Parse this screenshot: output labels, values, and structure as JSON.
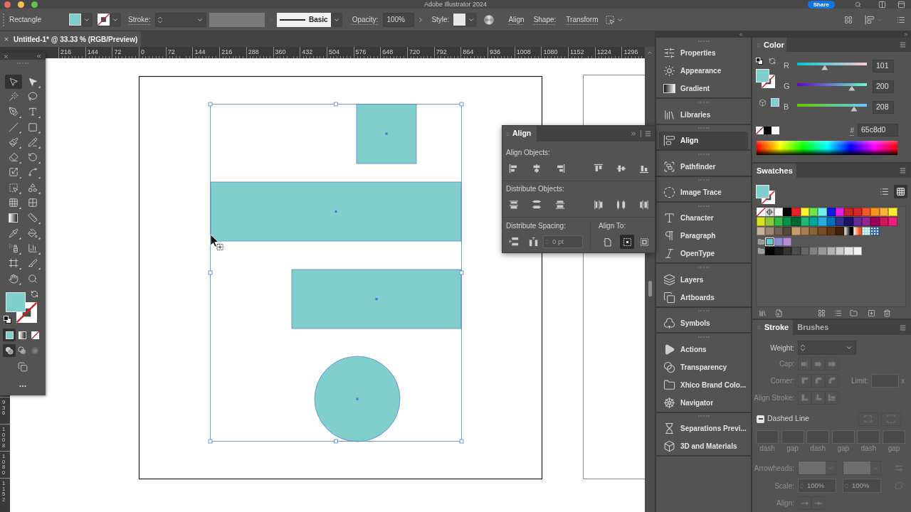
{
  "title_bar": {
    "title": "Adobe Illustrator 2024",
    "share": "Share"
  },
  "control_bar": {
    "object_type": "Rectangle",
    "stroke_label": "Stroke:",
    "brush": "Basic",
    "opacity_label": "Opacity:",
    "opacity": "100%",
    "style_label": "Style:",
    "links": [
      "Align",
      "Shape:",
      "Transform"
    ]
  },
  "document_tabs": [
    {
      "label": "Untitled-1* @ 33.33 % (RGB/Preview)",
      "selected": true
    }
  ],
  "horizontal_ruler": [
    "216",
    "144",
    "72",
    "0",
    "72",
    "144",
    "216",
    "288",
    "360",
    "432",
    "504",
    "576",
    "648",
    "720",
    "792",
    "864",
    "936",
    "1008",
    "1080",
    "1152",
    "1224",
    "1296"
  ],
  "vertical_ruler": [
    "936",
    "1008",
    "1080",
    "1152"
  ],
  "toolbar": {
    "tools": [
      {
        "kind": "selection",
        "selected": true,
        "flyout": false
      },
      {
        "kind": "direct-selection",
        "selected": false,
        "flyout": true
      },
      {
        "kind": "magic-wand",
        "selected": false,
        "flyout": false
      },
      {
        "kind": "lasso",
        "selected": false,
        "flyout": false
      },
      {
        "kind": "pen",
        "selected": false,
        "flyout": true
      },
      {
        "kind": "type",
        "selected": false,
        "flyout": true
      },
      {
        "kind": "line",
        "selected": false,
        "flyout": true
      },
      {
        "kind": "rectangle",
        "selected": false,
        "flyout": true
      },
      {
        "kind": "paintbrush",
        "selected": false,
        "flyout": true
      },
      {
        "kind": "shaper",
        "selected": false,
        "flyout": true
      },
      {
        "kind": "eraser",
        "selected": false,
        "flyout": true
      },
      {
        "kind": "rotate",
        "selected": false,
        "flyout": true
      },
      {
        "kind": "scale",
        "selected": false,
        "flyout": true
      },
      {
        "kind": "warp",
        "selected": false,
        "flyout": true
      },
      {
        "kind": "free-transform",
        "selected": false,
        "flyout": true
      },
      {
        "kind": "shape-builder",
        "selected": false,
        "flyout": true
      },
      {
        "kind": "perspective-grid",
        "selected": false,
        "flyout": true
      },
      {
        "kind": "mesh",
        "selected": false,
        "flyout": false
      },
      {
        "kind": "gradient",
        "selected": false,
        "flyout": false
      },
      {
        "kind": "measure",
        "selected": false,
        "flyout": true
      },
      {
        "kind": "eyedropper",
        "selected": false,
        "flyout": true
      },
      {
        "kind": "live-paint",
        "selected": false,
        "flyout": true
      },
      {
        "kind": "symbol-sprayer",
        "selected": false,
        "flyout": true
      },
      {
        "kind": "graph",
        "selected": false,
        "flyout": true
      },
      {
        "kind": "artboard",
        "selected": false,
        "flyout": true
      },
      {
        "kind": "knife",
        "selected": false,
        "flyout": true
      },
      {
        "kind": "hand",
        "selected": false,
        "flyout": true
      },
      {
        "kind": "zoom",
        "selected": false,
        "flyout": false
      }
    ],
    "fill_modes": [
      {
        "kind": "color",
        "selected": true
      },
      {
        "kind": "gradient",
        "selected": false
      },
      {
        "kind": "none",
        "selected": false
      }
    ],
    "draw_modes": [
      {
        "kind": "normal",
        "selected": true
      },
      {
        "kind": "behind",
        "selected": false
      },
      {
        "kind": "inside",
        "selected": false
      }
    ]
  },
  "align_panel": {
    "tab": "Align",
    "align_objects": "Align Objects:",
    "distribute_objects": "Distribute Objects:",
    "distribute_spacing": "Distribute Spacing:",
    "spacing_field": {
      "value": "0 pt",
      "disabled": true
    },
    "align_to": "Align To:",
    "align_to_options": [
      {
        "kind": "artboard",
        "selected": false
      },
      {
        "kind": "selection",
        "selected": true
      },
      {
        "kind": "key-object",
        "selected": false
      }
    ]
  },
  "dock": [
    {
      "items": [
        {
          "kind": "properties",
          "label": "Properties",
          "selected": false
        },
        {
          "kind": "appearance",
          "label": "Appearance",
          "selected": false
        },
        {
          "kind": "gradient",
          "label": "Gradient",
          "selected": false
        }
      ]
    },
    {
      "items": [
        {
          "kind": "libraries",
          "label": "Libraries",
          "selected": false
        }
      ]
    },
    {
      "items": [
        {
          "kind": "align",
          "label": "Align",
          "selected": true
        }
      ]
    },
    {
      "items": [
        {
          "kind": "pathfinder",
          "label": "Pathfinder",
          "selected": false
        }
      ]
    },
    {
      "items": [
        {
          "kind": "image-trace",
          "label": "Image Trace",
          "selected": false
        }
      ]
    },
    {
      "items": [
        {
          "kind": "character",
          "label": "Character",
          "selected": false
        },
        {
          "kind": "paragraph",
          "label": "Paragraph",
          "selected": false
        },
        {
          "kind": "opentype",
          "label": "OpenType",
          "selected": false
        }
      ]
    },
    {
      "items": [
        {
          "kind": "layers",
          "label": "Layers",
          "selected": false
        },
        {
          "kind": "artboards",
          "label": "Artboards",
          "selected": false
        }
      ]
    },
    {
      "items": [
        {
          "kind": "symbols",
          "label": "Symbols",
          "selected": false
        }
      ]
    },
    {
      "items": [
        {
          "kind": "actions",
          "label": "Actions",
          "selected": false
        },
        {
          "kind": "transparency",
          "label": "Transparency",
          "selected": false
        },
        {
          "kind": "library",
          "label": "Xhico Brand Colo...",
          "selected": false
        },
        {
          "kind": "navigator",
          "label": "Navigator",
          "selected": false
        }
      ]
    },
    {
      "items": [
        {
          "kind": "separations",
          "label": "Separations Previ...",
          "selected": false
        },
        {
          "kind": "materials",
          "label": "3D and Materials",
          "selected": false
        }
      ]
    }
  ],
  "color_panel": {
    "tab": "Color",
    "channels": [
      {
        "name": "R",
        "value": "101",
        "level": 0.396
      },
      {
        "name": "G",
        "value": "200",
        "level": 0.784
      },
      {
        "name": "B",
        "value": "208",
        "level": 0.816
      }
    ],
    "hex_label": "#",
    "hex": "65c8d0"
  },
  "swatches_panel": {
    "tab": "Swatches",
    "views": [
      {
        "kind": "list",
        "selected": false
      },
      {
        "kind": "grid",
        "selected": true
      }
    ],
    "rows": [
      [
        {
          "kind": "none",
          "selected": false
        },
        {
          "kind": "registration",
          "selected": false
        },
        {
          "kind": "color",
          "color": "#ffffff",
          "selected": false
        },
        {
          "kind": "color",
          "color": "#000000",
          "selected": false
        },
        {
          "kind": "color",
          "color": "#e52521",
          "selected": false
        },
        {
          "kind": "color",
          "color": "#fdf02f",
          "selected": false
        },
        {
          "kind": "color",
          "color": "#6ee54a",
          "selected": false
        },
        {
          "kind": "color",
          "color": "#71f0f0",
          "selected": false
        },
        {
          "kind": "color",
          "color": "#0b1ee0",
          "selected": false
        },
        {
          "kind": "color",
          "color": "#e11ee2",
          "selected": false
        },
        {
          "kind": "color",
          "color": "#c1272d",
          "selected": false
        },
        {
          "kind": "color",
          "color": "#d9272e",
          "selected": false
        },
        {
          "kind": "color",
          "color": "#ef5b2a",
          "selected": false
        },
        {
          "kind": "color",
          "color": "#f7931e",
          "selected": false
        },
        {
          "kind": "color",
          "color": "#fbb040",
          "selected": false
        },
        {
          "kind": "color",
          "color": "#f7ec32",
          "selected": false
        }
      ],
      [
        {
          "kind": "color",
          "color": "#d9e021",
          "selected": false
        },
        {
          "kind": "color",
          "color": "#8cc63f",
          "selected": false
        },
        {
          "kind": "color",
          "color": "#39b54a",
          "selected": false
        },
        {
          "kind": "color",
          "color": "#009245",
          "selected": false
        },
        {
          "kind": "color",
          "color": "#006837",
          "selected": false
        },
        {
          "kind": "color",
          "color": "#22b573",
          "selected": false
        },
        {
          "kind": "color",
          "color": "#00a99d",
          "selected": false
        },
        {
          "kind": "color",
          "color": "#29abe2",
          "selected": false
        },
        {
          "kind": "color",
          "color": "#0071bc",
          "selected": false
        },
        {
          "kind": "color",
          "color": "#2e3192",
          "selected": false
        },
        {
          "kind": "color",
          "color": "#1b1464",
          "selected": false
        },
        {
          "kind": "color",
          "color": "#662d91",
          "selected": false
        },
        {
          "kind": "color",
          "color": "#93278f",
          "selected": false
        },
        {
          "kind": "color",
          "color": "#9e005d",
          "selected": false
        },
        {
          "kind": "color",
          "color": "#d4145a",
          "selected": false
        },
        {
          "kind": "color",
          "color": "#ed1e79",
          "selected": false
        }
      ],
      [
        {
          "kind": "color",
          "color": "#c7b299",
          "selected": false
        },
        {
          "kind": "color",
          "color": "#998675",
          "selected": false
        },
        {
          "kind": "color",
          "color": "#736357",
          "selected": false
        },
        {
          "kind": "color",
          "color": "#534741",
          "selected": false
        },
        {
          "kind": "color",
          "color": "#c69c6d",
          "selected": false
        },
        {
          "kind": "color",
          "color": "#a67c52",
          "selected": false
        },
        {
          "kind": "color",
          "color": "#8c6239",
          "selected": false
        },
        {
          "kind": "color",
          "color": "#754c24",
          "selected": false
        },
        {
          "kind": "color",
          "color": "#603813",
          "selected": false
        },
        {
          "kind": "color",
          "color": "#42210b",
          "selected": false
        },
        {
          "kind": "gradient",
          "color": "#000000",
          "selected": false
        },
        {
          "kind": "gradient",
          "color": "#f15a24",
          "selected": false
        },
        {
          "kind": "pattern",
          "color": "#a8e6e6",
          "selected": false
        },
        {
          "kind": "pattern",
          "color": "#3f6fb6",
          "selected": false
        }
      ],
      [
        {
          "kind": "folder",
          "selected": false
        },
        {
          "kind": "color",
          "color": "#65c8d0",
          "selected": true
        },
        {
          "kind": "color",
          "color": "#8c8ccf",
          "selected": false
        },
        {
          "kind": "color",
          "color": "#b48fd0",
          "selected": false
        }
      ],
      [
        {
          "kind": "folder",
          "selected": false
        },
        {
          "kind": "color",
          "color": "#000000",
          "selected": false
        },
        {
          "kind": "color",
          "color": "#1a1a1a",
          "selected": false
        },
        {
          "kind": "color",
          "color": "#333333",
          "selected": false
        },
        {
          "kind": "color",
          "color": "#4d4d4d",
          "selected": false
        },
        {
          "kind": "color",
          "color": "#666666",
          "selected": false
        },
        {
          "kind": "color",
          "color": "#808080",
          "selected": false
        },
        {
          "kind": "color",
          "color": "#999999",
          "selected": false
        },
        {
          "kind": "color",
          "color": "#b3b3b3",
          "selected": false
        },
        {
          "kind": "color",
          "color": "#cccccc",
          "selected": false
        },
        {
          "kind": "color",
          "color": "#e6e6e6",
          "selected": false
        },
        {
          "kind": "color",
          "color": "#f2f2f2",
          "selected": false
        }
      ]
    ]
  },
  "stroke_panel": {
    "tabs": [
      {
        "label": "Stroke",
        "selected": true
      },
      {
        "label": "Brushes",
        "selected": false
      }
    ],
    "weight": {
      "label": "Weight:",
      "disabled": false
    },
    "cap": {
      "label": "Cap:",
      "disabled": true
    },
    "corner": {
      "label": "Corner:",
      "disabled": true
    },
    "limit": {
      "label": "Limit:",
      "unit": "x",
      "disabled": true
    },
    "align_stroke": {
      "label": "Align Stroke:",
      "disabled": true
    },
    "dashed_line": {
      "label": "Dashed Line",
      "mixed": true
    },
    "dashes": {
      "labels": [
        "dash",
        "gap",
        "dash",
        "gap",
        "dash",
        "gap"
      ],
      "disabled": true
    },
    "arrowheads": {
      "label": "Arrowheads:",
      "disabled": true
    },
    "scale": {
      "label": "Scale:",
      "values": [
        "100%",
        "100%"
      ],
      "disabled": true
    },
    "align": {
      "label": "Align:",
      "disabled": true
    }
  }
}
